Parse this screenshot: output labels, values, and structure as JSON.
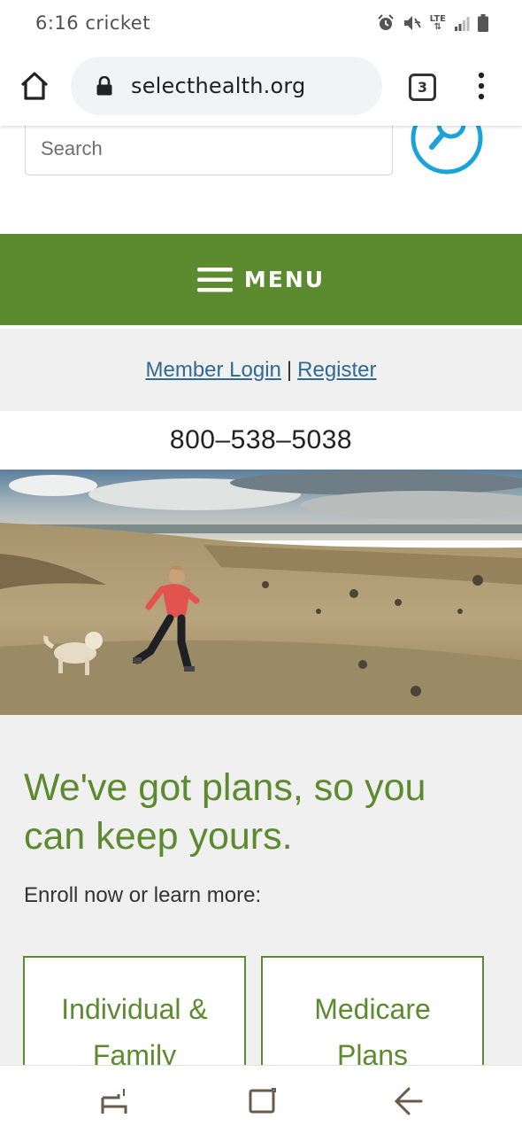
{
  "status_bar": {
    "time_carrier": "6:16 cricket",
    "network": "LTE"
  },
  "browser": {
    "url": "selecthealth.org",
    "tab_count": "3"
  },
  "search": {
    "placeholder": "Search"
  },
  "menu": {
    "label": "MENU"
  },
  "account": {
    "login_label": "Member Login",
    "separator": "|",
    "register_label": "Register"
  },
  "phone": "800–538–5038",
  "main": {
    "headline": "We've got plans, so you can keep yours.",
    "subtext": "Enroll now or learn more:",
    "plans": [
      {
        "label": "Individual & Family"
      },
      {
        "label": "Medicare Plans"
      }
    ]
  },
  "colors": {
    "brand_green": "#5c8a2e",
    "link_blue": "#2f6a91",
    "search_blue": "#1aa3d9"
  },
  "icons": [
    "home-icon",
    "lock-icon",
    "tabs-icon",
    "more-vert-icon",
    "search-icon",
    "hamburger-icon",
    "recent-apps-icon",
    "home-nav-icon",
    "back-icon"
  ]
}
